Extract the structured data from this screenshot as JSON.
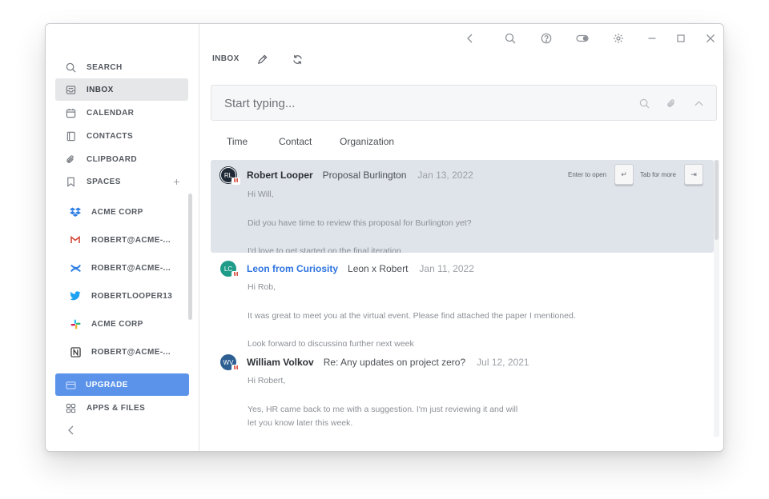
{
  "sidebar": {
    "nav": [
      {
        "label": "SEARCH",
        "icon": "search-icon"
      },
      {
        "label": "INBOX",
        "icon": "inbox-icon",
        "active": true
      },
      {
        "label": "CALENDAR",
        "icon": "calendar-icon"
      },
      {
        "label": "CONTACTS",
        "icon": "contacts-icon"
      },
      {
        "label": "CLIPBOARD",
        "icon": "paperclip-icon"
      },
      {
        "label": "SPACES",
        "icon": "bookmark-icon",
        "action": "+"
      }
    ],
    "spaces": [
      {
        "label": "ACME CORP",
        "icon": "dropbox-icon"
      },
      {
        "label": "ROBERT@ACME-...",
        "icon": "gmail-icon"
      },
      {
        "label": "ROBERT@ACME-...",
        "icon": "confluence-icon"
      },
      {
        "label": "ROBERTLOOPER13",
        "icon": "twitter-icon"
      },
      {
        "label": "ACME CORP",
        "icon": "slack-icon"
      },
      {
        "label": "ROBERT@ACME-...",
        "icon": "notion-icon"
      }
    ],
    "upgrade": {
      "label": "UPGRADE",
      "icon": "upgrade-icon"
    },
    "apps": {
      "label": "APPS & FILES",
      "icon": "apps-grid-icon"
    }
  },
  "toolbar": {
    "title": "INBOX"
  },
  "search": {
    "placeholder": "Start typing..."
  },
  "filters": [
    "Time",
    "Contact",
    "Organization"
  ],
  "hints": {
    "enter": "Enter to open",
    "enter_key": "↵",
    "tab": "Tab for more",
    "tab_key": "⇥"
  },
  "messages": [
    {
      "initials": "RL",
      "avatar_color": "#1f2a36",
      "sender": "Robert Looper",
      "sender_is_link": false,
      "subject": "Proposal Burlington",
      "date": "Jan 13, 2022",
      "lines": [
        "Hi Will,",
        "Did you have time to review this proposal for Burlington yet?",
        "I'd love to get started on the final iteration"
      ],
      "selected": true
    },
    {
      "initials": "LC",
      "avatar_color": "#1f9b8a",
      "sender": "Leon from Curiosity",
      "sender_is_link": true,
      "subject": "Leon x Robert",
      "date": "Jan 11, 2022",
      "lines": [
        "Hi Rob,",
        "It was great to meet you at the virtual event. Please find attached the paper I mentioned.",
        "Look forward to discussing further next week"
      ],
      "selected": false
    },
    {
      "initials": "WV",
      "avatar_color": "#2d5f92",
      "sender": "William Volkov",
      "sender_is_link": false,
      "subject": "Re: Any updates on project zero?",
      "date": "Jul 12, 2021",
      "lines": [
        "Hi Robert,",
        "Yes, HR came back to me with a suggestion. I'm just reviewing it and will",
        "let you know later this week."
      ],
      "selected": false
    }
  ],
  "colors": {
    "accent": "#5b93ea",
    "link": "#2f74e0",
    "selected_row": "#dfe3ea"
  }
}
